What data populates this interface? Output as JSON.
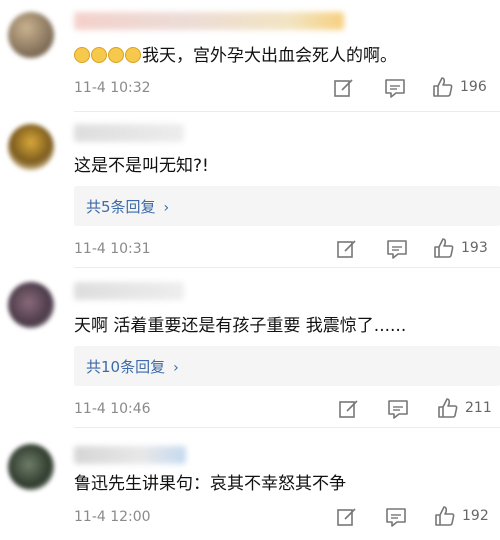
{
  "comments": [
    {
      "text": "我天，宫外孕大出血会死人的啊。",
      "timestamp": "11-4 10:32",
      "likes": "196",
      "emoji_count": 4
    },
    {
      "text": "这是不是叫无知?!",
      "replies_label": "共5条回复",
      "timestamp": "11-4 10:31",
      "likes": "193"
    },
    {
      "text": "天啊 活着重要还是有孩子重要 我震惊了......",
      "replies_label": "共10条回复",
      "timestamp": "11-4 10:46",
      "likes": "211"
    },
    {
      "text": "鲁迅先生讲果句：哀其不幸怒其不争",
      "timestamp": "11-4 12:00",
      "likes": "192"
    }
  ],
  "icons": {
    "edit": "edit-icon",
    "comment": "comment-icon",
    "like": "thumbs-up-icon",
    "chevron": "chevron-right-icon"
  },
  "colors": {
    "link": "#3d6aa8",
    "meta": "#8a8a8a",
    "reply_bg": "#f5f5f5"
  }
}
